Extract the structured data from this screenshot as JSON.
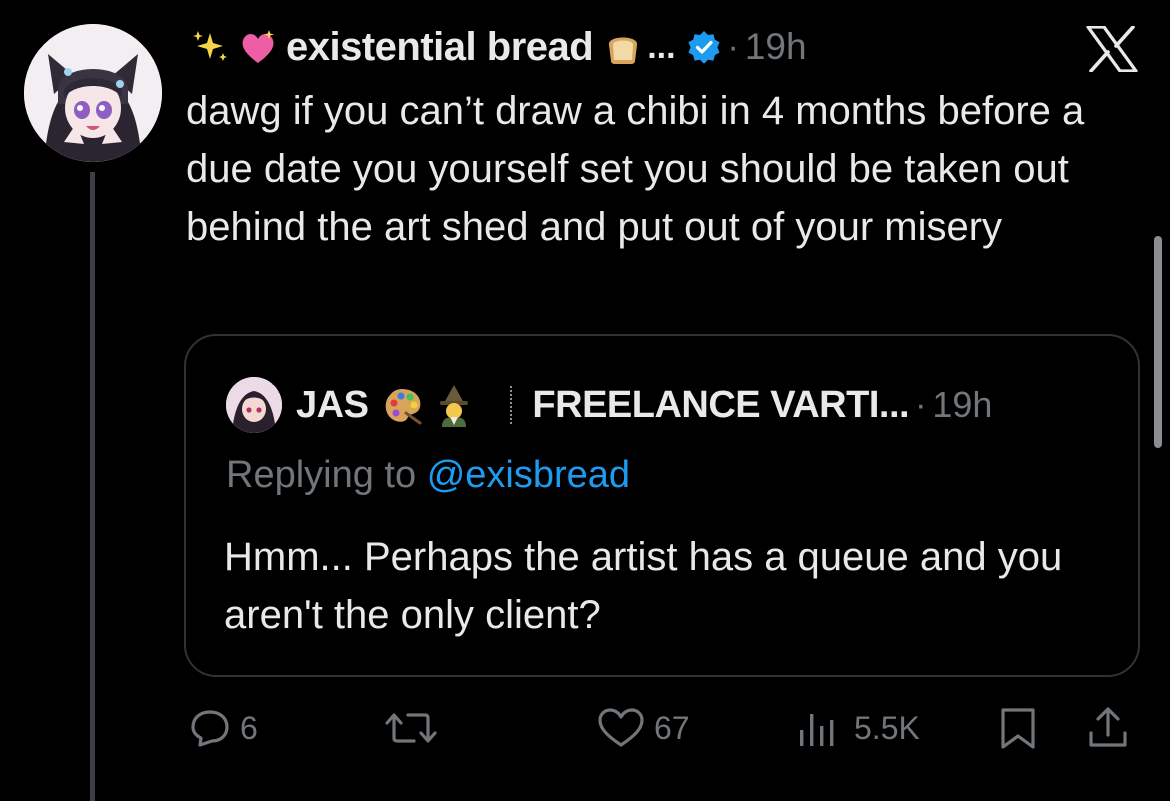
{
  "author": {
    "display_name": "existential bread",
    "emoji_prefix": [
      "sparkles-emoji",
      "sparkling-heart-emoji"
    ],
    "emoji_suffix": [
      "bread-emoji"
    ],
    "truncation": "...",
    "verified": true,
    "time": "19h",
    "separator": "·"
  },
  "close_icon": "x-logo-icon",
  "tweet": {
    "text": "dawg if you can’t draw a chibi in 4 months before a due date you yourself set you should be taken out behind the art shed and put out of your misery"
  },
  "quote": {
    "display_name": "JAS",
    "emojis": [
      "artist-palette-emoji",
      "mage-emoji"
    ],
    "title": "FREELANCE VARTI...",
    "separator": "·",
    "time": "19h",
    "replying_prefix": "Replying to",
    "replying_handle": "@exisbread",
    "text": "Hmm... Perhaps the artist has a queue and you aren't the only client?"
  },
  "actions": {
    "replies": "6",
    "reposts": "",
    "likes": "67",
    "views": "5.5K"
  },
  "colors": {
    "background": "#000000",
    "text": "#e7e9ea",
    "secondary": "#71767b",
    "accent": "#1d9bf0",
    "border": "#2f3336"
  }
}
